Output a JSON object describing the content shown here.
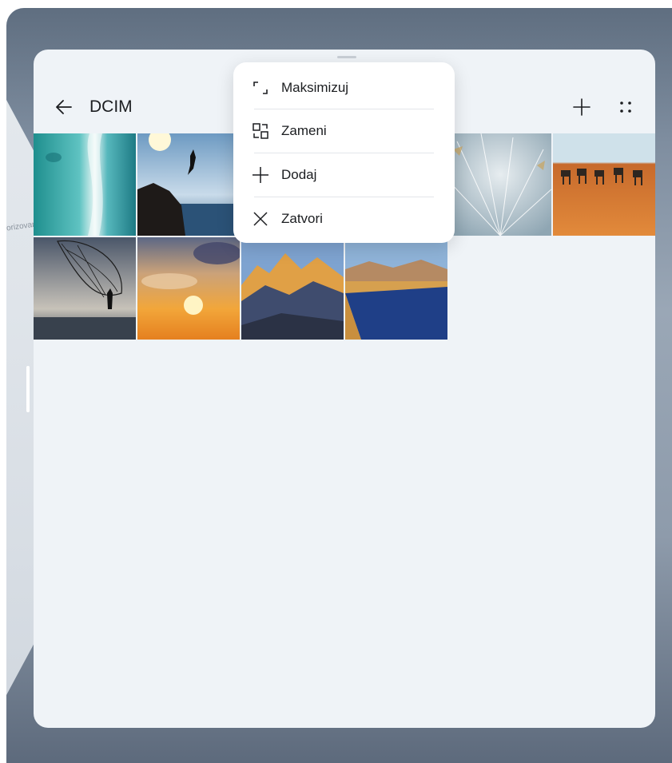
{
  "background_window": {
    "clipped_text": "orizovan"
  },
  "header": {
    "title": "DCIM",
    "back_icon": "arrow-left-icon",
    "add_icon": "plus-icon",
    "more_icon": "four-dots-icon"
  },
  "context_menu": {
    "items": [
      {
        "label": "Maksimizuj",
        "icon": "maximize-icon"
      },
      {
        "label": "Zameni",
        "icon": "swap-icon"
      },
      {
        "label": "Dodaj",
        "icon": "plus-icon"
      },
      {
        "label": "Zatvori",
        "icon": "close-icon"
      }
    ]
  },
  "photos": [
    {
      "subject": "aerial turquoise sea"
    },
    {
      "subject": "cliff jumper at sunset"
    },
    {
      "subject": "dandelion seeds"
    },
    {
      "subject": "camel caravan in desert"
    },
    {
      "subject": "fisherman throwing net"
    },
    {
      "subject": "sunset over clouds"
    },
    {
      "subject": "golden mountain peaks"
    },
    {
      "subject": "lake in desert valley"
    }
  ],
  "colors": {
    "window_bg": "#eff3f7",
    "menu_bg": "#ffffff",
    "text": "#1b1d20"
  }
}
